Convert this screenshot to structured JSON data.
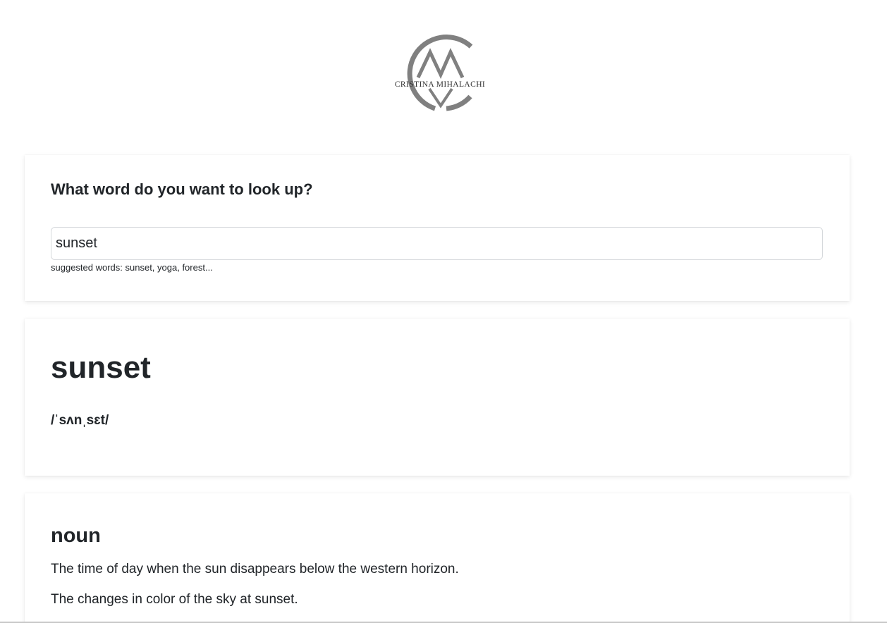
{
  "logo": {
    "text": "CRISTINA MIHALACHI",
    "color": "#808080"
  },
  "search": {
    "heading": "What word do you want to look up?",
    "value": "sunset",
    "hint": "suggested words: sunset, yoga, forest..."
  },
  "result": {
    "word": "sunset",
    "phonetic": "/ˈsʌnˌsɛt/"
  },
  "meaning": {
    "part_of_speech": "noun",
    "definitions": [
      "The time of day when the sun disappears below the western horizon.",
      "The changes in color of the sky at sunset."
    ]
  }
}
